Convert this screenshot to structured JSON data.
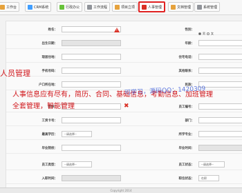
{
  "nav": {
    "tabs": [
      {
        "label": "工作台",
        "color": "#e6a23c"
      },
      {
        "label": "CRM系统",
        "color": "#409eff"
      },
      {
        "label": "行政办公",
        "color": "#67c23a"
      },
      {
        "label": "工作流程",
        "color": "#909399"
      },
      {
        "label": "项目立项",
        "color": "#e6a23c"
      },
      {
        "label": "人事管理",
        "color": "#d93025",
        "active": true
      },
      {
        "label": "文档管理",
        "color": "#e6a23c"
      },
      {
        "label": "系统管理",
        "color": "#909399"
      }
    ]
  },
  "form": {
    "name_label": "姓名：",
    "gender_label": "性别：",
    "gender_male": "男",
    "gender_female": "女",
    "birth_label": "出生日期：",
    "age_label": "年龄：",
    "current_address_label": "现居住地：",
    "home_phone_label": "住宅电话：",
    "mobile_label": "手机号码：",
    "other_contact_label": "其他联系：",
    "hukou_label": "户口所在地：",
    "ethnicity_label": "民族：",
    "position_label": "职称：",
    "employee_id_label": "员工编号：",
    "job_number_label": "工资卡号：",
    "dept_label": "部门：",
    "education_label": "最高学历：",
    "education_value": "--请选择--",
    "graduate_major_label": "所学专业：",
    "school_label": "毕业院校：",
    "grad_time_label": "毕业时间：",
    "emp_type_label": "员工类型：",
    "emp_type_value": "--请选择--",
    "emp_status_label": "员工状态：",
    "emp_status_value": "--请选择--",
    "hire_date_label": "入职时间：",
    "status_label": "职位状态：",
    "status_value": "在职"
  },
  "overlay": {
    "title": "人员管理",
    "desc_line1": "人事信息应有尽有，简历、合同、基础信息，考勤信息、加班管理",
    "desc_line2": "全套管理，智能管理",
    "watermark": "可学习，源码QQ：1420309"
  },
  "footer": {
    "text": "Copyright 2014"
  }
}
